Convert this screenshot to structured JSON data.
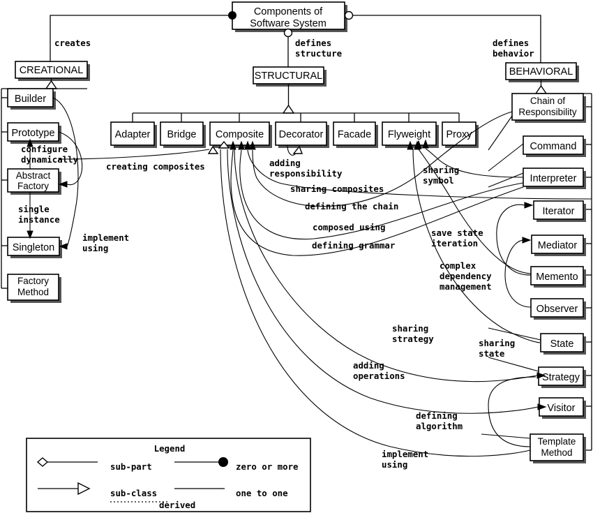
{
  "title": "Components of Software System",
  "title_lines": [
    "Components of",
    "Software System"
  ],
  "categories": [
    {
      "id": "creational",
      "label": "CREATIONAL",
      "edge_label": "creates"
    },
    {
      "id": "structural",
      "label": "STRUCTURAL",
      "edge_label_lines": [
        "defines",
        "structure"
      ]
    },
    {
      "id": "behavioral",
      "label": "BEHAVIORAL",
      "edge_label_lines": [
        "defines",
        "behavior"
      ]
    }
  ],
  "creational_patterns": [
    {
      "label": "Builder"
    },
    {
      "label": "Prototype"
    },
    {
      "label_lines": [
        "Abstract",
        "Factory"
      ]
    },
    {
      "label": "Singleton"
    },
    {
      "label_lines": [
        "Factory",
        "Method"
      ]
    }
  ],
  "structural_patterns": [
    {
      "label": "Adapter"
    },
    {
      "label": "Bridge"
    },
    {
      "label": "Composite"
    },
    {
      "label": "Decorator"
    },
    {
      "label": "Facade"
    },
    {
      "label": "Flyweight"
    },
    {
      "label": "Proxy"
    }
  ],
  "behavioral_patterns": [
    {
      "label_lines": [
        "Chain of",
        "Responsibility"
      ]
    },
    {
      "label": "Command"
    },
    {
      "label": "Interpreter"
    },
    {
      "label": "Iterator"
    },
    {
      "label": "Mediator"
    },
    {
      "label": "Memento"
    },
    {
      "label": "Observer"
    },
    {
      "label": "State"
    },
    {
      "label": "Strategy"
    },
    {
      "label": "Visitor"
    },
    {
      "label_lines": [
        "Template",
        "Method"
      ]
    }
  ],
  "relationship_labels": {
    "creates": "creates",
    "defines_structure_1": "defines",
    "defines_structure_2": "structure",
    "defines_behavior_1": "defines",
    "defines_behavior_2": "behavior",
    "configure_dynamically_1": "configure",
    "configure_dynamically_2": "dynamically",
    "single_instance_1": "single",
    "single_instance_2": "instance",
    "implement_using_left_1": "implement",
    "implement_using_left_2": "using",
    "creating_composites": "creating composites",
    "adding_responsibility_1": "adding",
    "adding_responsibility_2": "responsibility",
    "sharing_composites": "sharing composites",
    "defining_the_chain": "defining the chain",
    "composed_using": "composed using",
    "defining_grammar": "defining grammar",
    "sharing_symbol_1": "sharing",
    "sharing_symbol_2": "symbol",
    "save_state_iteration_1": "save state",
    "save_state_iteration_2": "iteration",
    "complex_dependency_management_1": "complex",
    "complex_dependency_management_2": "dependency",
    "complex_dependency_management_3": "management",
    "sharing_strategy_1": "sharing",
    "sharing_strategy_2": "strategy",
    "sharing_state_1": "sharing",
    "sharing_state_2": "state",
    "adding_operations_1": "adding",
    "adding_operations_2": "operations",
    "defining_algorithm_1": "defining",
    "defining_algorithm_2": "algorithm",
    "implement_using_bottom_1": "implement",
    "implement_using_bottom_2": "using"
  },
  "legend": {
    "title": "Legend",
    "entries": [
      {
        "symbol": "diamond-line",
        "label": "sub-part"
      },
      {
        "symbol": "line-filled-circle",
        "label": "zero or more"
      },
      {
        "symbol": "line-hollow-triangle",
        "label": "sub-class"
      },
      {
        "symbol": "plain-line",
        "label": "one to one"
      },
      {
        "symbol": "dotted-line",
        "label": "derived"
      }
    ]
  },
  "colors": {
    "stroke": "#000000",
    "background": "#ffffff",
    "shadow": "#555555"
  }
}
